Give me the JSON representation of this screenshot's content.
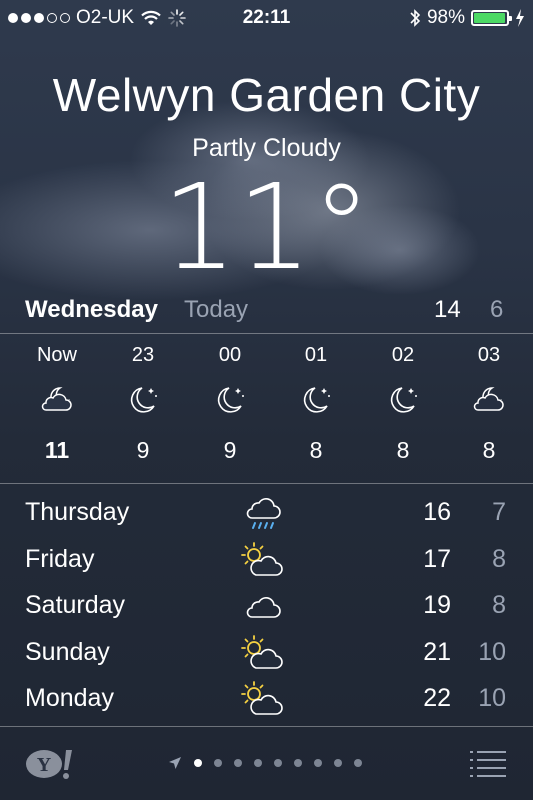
{
  "status_bar": {
    "carrier": "O2-UK",
    "time": "22:11",
    "battery": "98%",
    "battery_level": 0.98,
    "signal_bars": 3,
    "signal_total": 5,
    "icons": [
      "wifi-icon",
      "activity-spinner-icon",
      "bluetooth-icon",
      "charging-bolt-icon"
    ],
    "battery_color": "#4cd964"
  },
  "location": {
    "city": "Welwyn Garden City",
    "condition": "Partly Cloudy",
    "temperature": "11°"
  },
  "today": {
    "day": "Wednesday",
    "label": "Today",
    "high": "14",
    "low": "6"
  },
  "hourly": [
    {
      "time": "Now",
      "icon": "partly-cloudy-night-icon",
      "temp": "11"
    },
    {
      "time": "23",
      "icon": "moon-stars-icon",
      "temp": "9"
    },
    {
      "time": "00",
      "icon": "moon-stars-icon",
      "temp": "9"
    },
    {
      "time": "01",
      "icon": "moon-stars-icon",
      "temp": "8"
    },
    {
      "time": "02",
      "icon": "moon-stars-icon",
      "temp": "8"
    },
    {
      "time": "03",
      "icon": "partly-cloudy-night-icon",
      "temp": "8"
    }
  ],
  "daily": [
    {
      "day": "Thursday",
      "icon": "rain-cloud-icon",
      "high": "16",
      "low": "7"
    },
    {
      "day": "Friday",
      "icon": "partly-sunny-icon",
      "high": "17",
      "low": "8"
    },
    {
      "day": "Saturday",
      "icon": "cloud-icon",
      "high": "19",
      "low": "8"
    },
    {
      "day": "Sunday",
      "icon": "partly-sunny-icon",
      "high": "21",
      "low": "10"
    },
    {
      "day": "Monday",
      "icon": "partly-sunny-icon",
      "high": "22",
      "low": "10"
    }
  ],
  "bottom_bar": {
    "logo": "Y!",
    "page_count": 10,
    "active_page": 0,
    "icons": [
      "yahoo-logo-icon",
      "location-arrow-icon",
      "list-icon"
    ]
  },
  "colors": {
    "secondary_text": "#9aa3b3",
    "sun": "#f5d142",
    "rain": "#5ab0f0"
  }
}
